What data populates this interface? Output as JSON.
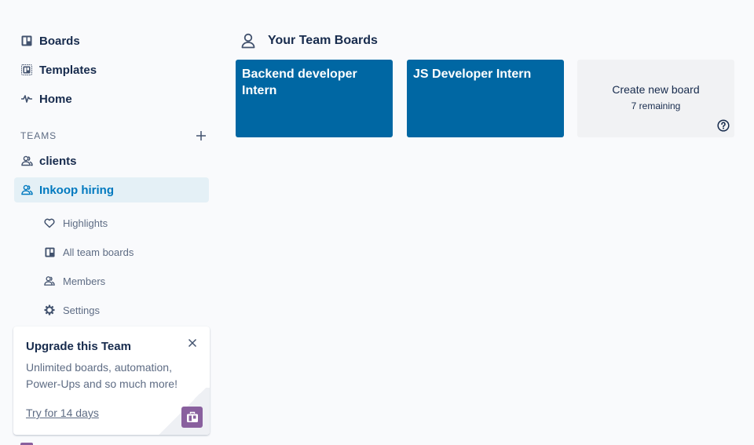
{
  "sidebar": {
    "main_nav": [
      {
        "label": "Boards",
        "icon": "board-icon"
      },
      {
        "label": "Templates",
        "icon": "template-icon"
      },
      {
        "label": "Home",
        "icon": "activity-icon"
      }
    ],
    "teams_label": "TEAMS",
    "add_team_icon": "plus-icon",
    "teams": [
      {
        "label": "clients",
        "icon": "team-icon",
        "active": false
      },
      {
        "label": "Inkoop hiring",
        "icon": "team-icon",
        "active": true
      }
    ],
    "team_sub_items": [
      {
        "label": "Highlights",
        "icon": "heart-icon"
      },
      {
        "label": "All team boards",
        "icon": "board-icon"
      },
      {
        "label": "Members",
        "icon": "members-icon"
      },
      {
        "label": "Settings",
        "icon": "gear-icon"
      }
    ],
    "upgrade": {
      "title": "Upgrade this Team",
      "body": "Unlimited boards, automation, Power-Ups and so much more!",
      "link": "Try for 14 days",
      "close_icon": "close-icon",
      "badge_icon": "briefcase-icon",
      "badge_color": "#89609e"
    }
  },
  "main": {
    "header_icon": "person-icon",
    "title": "Your Team Boards",
    "boards": [
      {
        "name": "Backend developer Intern",
        "color": "#0067a3"
      },
      {
        "name": "JS Developer Intern",
        "color": "#0067a3"
      }
    ],
    "create": {
      "label": "Create new board",
      "remaining": "7 remaining",
      "help_icon": "help-icon"
    }
  },
  "colors": {
    "accent": "#0079bf",
    "active_bg": "#e4f0f6",
    "text": "#172b4d",
    "muted": "#5e6c84"
  }
}
